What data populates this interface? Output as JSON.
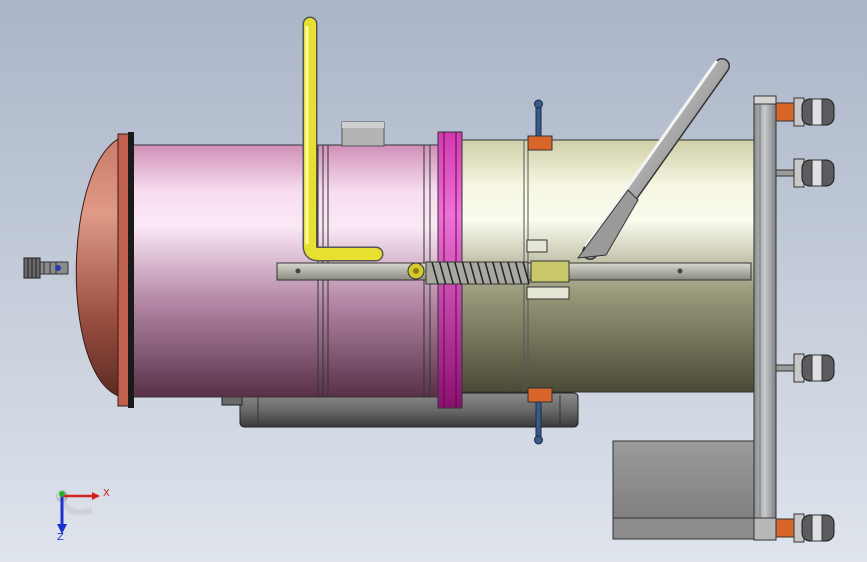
{
  "viewport": {
    "background_top": "#aab5c8",
    "background_bottom": "#dfe4ec"
  },
  "triad": {
    "x_label": "X",
    "z_label": "Z",
    "x_color": "#d42020",
    "y_color": "#22b022",
    "z_color": "#1d2fd0"
  },
  "colors": {
    "front_drum": "#d98fb8",
    "rear_drum": "#d9d8b4",
    "end_cap": "#c26050",
    "magenta_ring": "#d12ca8",
    "yellow_pipe": "#e8e030",
    "copper_blocks": "#d8662a",
    "frame": "#a4a8ac",
    "wheels": "#5a5c60"
  }
}
